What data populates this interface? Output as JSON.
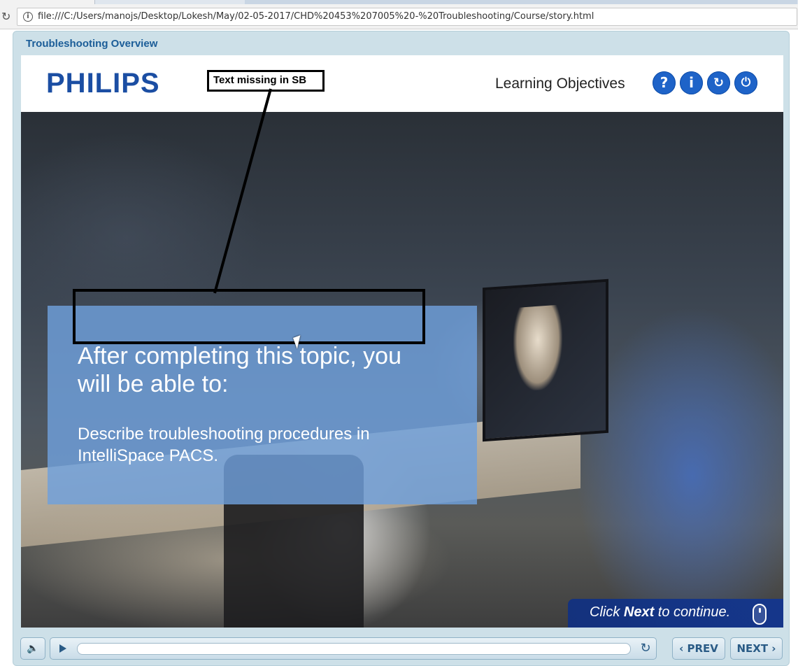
{
  "browser": {
    "url": "file:///C:/Users/manojs/Desktop/Lokesh/May/02-05-2017/CHD%20453%207005%20-%20Troubleshooting/Course/story.html"
  },
  "player": {
    "title": "Troubleshooting Overview"
  },
  "header": {
    "logo": "PHILIPS",
    "section_title": "Learning Objectives",
    "buttons": {
      "help": "?",
      "info": "i",
      "replay": "↻",
      "exit": "⏻"
    }
  },
  "content": {
    "heading": "After completing this topic, you will be able to:",
    "body": "Describe troubleshooting procedures in IntelliSpace PACS."
  },
  "annotation": {
    "label": "Text missing in SB"
  },
  "continue": {
    "prefix": "Click ",
    "next_word": "Next",
    "suffix": " to continue."
  },
  "controls": {
    "volume": "🔈",
    "replay": "↻",
    "prev": "‹ PREV",
    "next": "NEXT ›"
  },
  "colors": {
    "brand_blue": "#1b4ea3",
    "button_blue": "#1e63c8",
    "panel_blue": "#6fa0dc",
    "title_blue": "#1b5d98"
  }
}
